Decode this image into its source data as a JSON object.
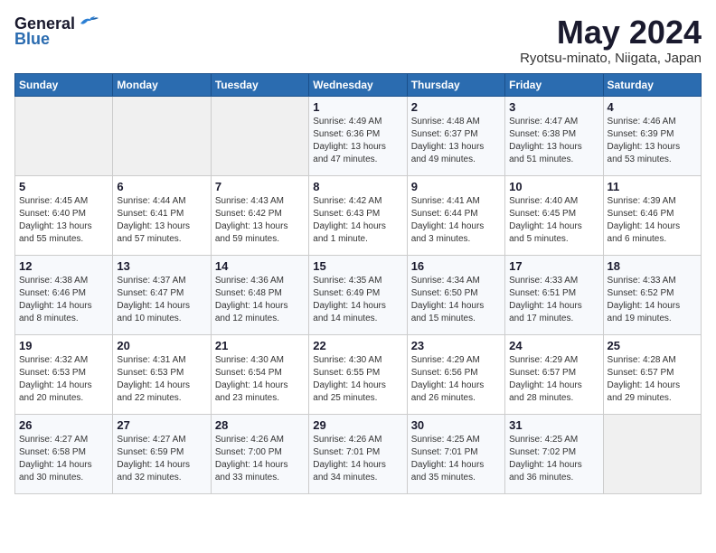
{
  "logo": {
    "general": "General",
    "blue": "Blue"
  },
  "title": "May 2024",
  "location": "Ryotsu-minato, Niigata, Japan",
  "weekdays": [
    "Sunday",
    "Monday",
    "Tuesday",
    "Wednesday",
    "Thursday",
    "Friday",
    "Saturday"
  ],
  "weeks": [
    [
      {
        "day": "",
        "info": ""
      },
      {
        "day": "",
        "info": ""
      },
      {
        "day": "",
        "info": ""
      },
      {
        "day": "1",
        "info": "Sunrise: 4:49 AM\nSunset: 6:36 PM\nDaylight: 13 hours\nand 47 minutes."
      },
      {
        "day": "2",
        "info": "Sunrise: 4:48 AM\nSunset: 6:37 PM\nDaylight: 13 hours\nand 49 minutes."
      },
      {
        "day": "3",
        "info": "Sunrise: 4:47 AM\nSunset: 6:38 PM\nDaylight: 13 hours\nand 51 minutes."
      },
      {
        "day": "4",
        "info": "Sunrise: 4:46 AM\nSunset: 6:39 PM\nDaylight: 13 hours\nand 53 minutes."
      }
    ],
    [
      {
        "day": "5",
        "info": "Sunrise: 4:45 AM\nSunset: 6:40 PM\nDaylight: 13 hours\nand 55 minutes."
      },
      {
        "day": "6",
        "info": "Sunrise: 4:44 AM\nSunset: 6:41 PM\nDaylight: 13 hours\nand 57 minutes."
      },
      {
        "day": "7",
        "info": "Sunrise: 4:43 AM\nSunset: 6:42 PM\nDaylight: 13 hours\nand 59 minutes."
      },
      {
        "day": "8",
        "info": "Sunrise: 4:42 AM\nSunset: 6:43 PM\nDaylight: 14 hours\nand 1 minute."
      },
      {
        "day": "9",
        "info": "Sunrise: 4:41 AM\nSunset: 6:44 PM\nDaylight: 14 hours\nand 3 minutes."
      },
      {
        "day": "10",
        "info": "Sunrise: 4:40 AM\nSunset: 6:45 PM\nDaylight: 14 hours\nand 5 minutes."
      },
      {
        "day": "11",
        "info": "Sunrise: 4:39 AM\nSunset: 6:46 PM\nDaylight: 14 hours\nand 6 minutes."
      }
    ],
    [
      {
        "day": "12",
        "info": "Sunrise: 4:38 AM\nSunset: 6:46 PM\nDaylight: 14 hours\nand 8 minutes."
      },
      {
        "day": "13",
        "info": "Sunrise: 4:37 AM\nSunset: 6:47 PM\nDaylight: 14 hours\nand 10 minutes."
      },
      {
        "day": "14",
        "info": "Sunrise: 4:36 AM\nSunset: 6:48 PM\nDaylight: 14 hours\nand 12 minutes."
      },
      {
        "day": "15",
        "info": "Sunrise: 4:35 AM\nSunset: 6:49 PM\nDaylight: 14 hours\nand 14 minutes."
      },
      {
        "day": "16",
        "info": "Sunrise: 4:34 AM\nSunset: 6:50 PM\nDaylight: 14 hours\nand 15 minutes."
      },
      {
        "day": "17",
        "info": "Sunrise: 4:33 AM\nSunset: 6:51 PM\nDaylight: 14 hours\nand 17 minutes."
      },
      {
        "day": "18",
        "info": "Sunrise: 4:33 AM\nSunset: 6:52 PM\nDaylight: 14 hours\nand 19 minutes."
      }
    ],
    [
      {
        "day": "19",
        "info": "Sunrise: 4:32 AM\nSunset: 6:53 PM\nDaylight: 14 hours\nand 20 minutes."
      },
      {
        "day": "20",
        "info": "Sunrise: 4:31 AM\nSunset: 6:53 PM\nDaylight: 14 hours\nand 22 minutes."
      },
      {
        "day": "21",
        "info": "Sunrise: 4:30 AM\nSunset: 6:54 PM\nDaylight: 14 hours\nand 23 minutes."
      },
      {
        "day": "22",
        "info": "Sunrise: 4:30 AM\nSunset: 6:55 PM\nDaylight: 14 hours\nand 25 minutes."
      },
      {
        "day": "23",
        "info": "Sunrise: 4:29 AM\nSunset: 6:56 PM\nDaylight: 14 hours\nand 26 minutes."
      },
      {
        "day": "24",
        "info": "Sunrise: 4:29 AM\nSunset: 6:57 PM\nDaylight: 14 hours\nand 28 minutes."
      },
      {
        "day": "25",
        "info": "Sunrise: 4:28 AM\nSunset: 6:57 PM\nDaylight: 14 hours\nand 29 minutes."
      }
    ],
    [
      {
        "day": "26",
        "info": "Sunrise: 4:27 AM\nSunset: 6:58 PM\nDaylight: 14 hours\nand 30 minutes."
      },
      {
        "day": "27",
        "info": "Sunrise: 4:27 AM\nSunset: 6:59 PM\nDaylight: 14 hours\nand 32 minutes."
      },
      {
        "day": "28",
        "info": "Sunrise: 4:26 AM\nSunset: 7:00 PM\nDaylight: 14 hours\nand 33 minutes."
      },
      {
        "day": "29",
        "info": "Sunrise: 4:26 AM\nSunset: 7:01 PM\nDaylight: 14 hours\nand 34 minutes."
      },
      {
        "day": "30",
        "info": "Sunrise: 4:25 AM\nSunset: 7:01 PM\nDaylight: 14 hours\nand 35 minutes."
      },
      {
        "day": "31",
        "info": "Sunrise: 4:25 AM\nSunset: 7:02 PM\nDaylight: 14 hours\nand 36 minutes."
      },
      {
        "day": "",
        "info": ""
      }
    ]
  ]
}
